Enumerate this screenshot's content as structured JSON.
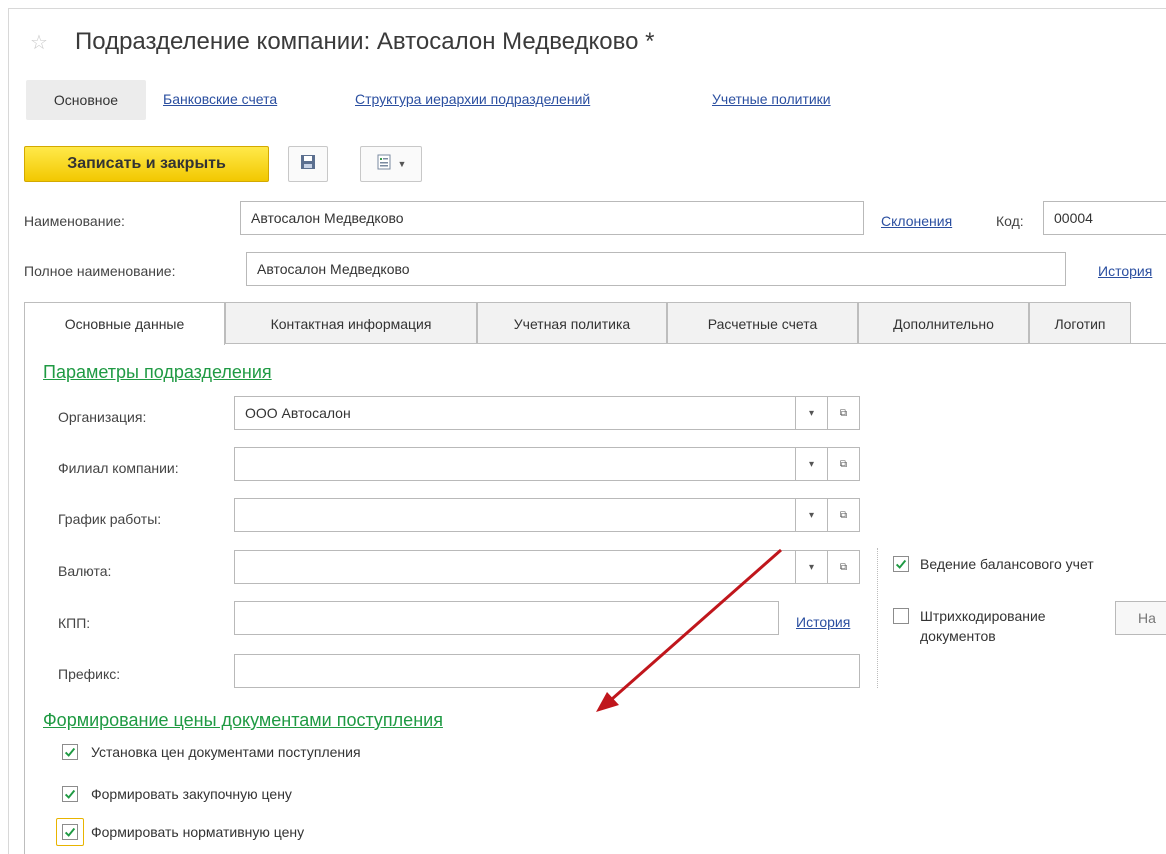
{
  "window": {
    "title": "Подразделение компании: Автосалон Медведково *"
  },
  "nav": {
    "active": "Основное",
    "links": [
      "Банковские счета",
      "Структура иерархии подразделений",
      "Учетные политики"
    ]
  },
  "toolbar": {
    "save_close_label": "Записать и закрыть"
  },
  "form": {
    "name_label": "Наименование:",
    "name_value": "Автосалон Медведково",
    "declensions_link": "Склонения",
    "code_label": "Код:",
    "code_value": "00004",
    "full_name_label": "Полное наименование:",
    "full_name_value": "Автосалон Медведково",
    "history_link": "История"
  },
  "tabs": [
    "Основные данные",
    "Контактная информация",
    "Учетная политика",
    "Расчетные счета",
    "Дополнительно",
    "Логотип"
  ],
  "section1": {
    "title": "Параметры подразделения",
    "organization_label": "Организация:",
    "organization_value": "ООО Автосалон",
    "branch_label": "Филиал компании:",
    "branch_value": "",
    "schedule_label": "График работы:",
    "schedule_value": "",
    "currency_label": "Валюта:",
    "currency_value": "",
    "kpp_label": "КПП:",
    "kpp_value": "",
    "kpp_history_link": "История",
    "prefix_label": "Префикс:",
    "prefix_value": ""
  },
  "right_options": {
    "balance_label": "Ведение балансового учет",
    "balance_checked": true,
    "barcode_label_line1": "Штрихкодирование",
    "barcode_label_line2": "документов",
    "barcode_checked": false,
    "setup_button": "На"
  },
  "section2": {
    "title": "Формирование цены документами поступления",
    "items": [
      {
        "label": "Установка цен документами поступления",
        "checked": true
      },
      {
        "label": "Формировать закупочную цену",
        "checked": true
      },
      {
        "label": "Формировать нормативную цену",
        "checked": true
      }
    ]
  },
  "colors": {
    "accent_green": "#1f9a43",
    "link_blue": "#2b4fa0",
    "primary_yellow": "#f2c800",
    "arrow_red": "#c0161c"
  }
}
